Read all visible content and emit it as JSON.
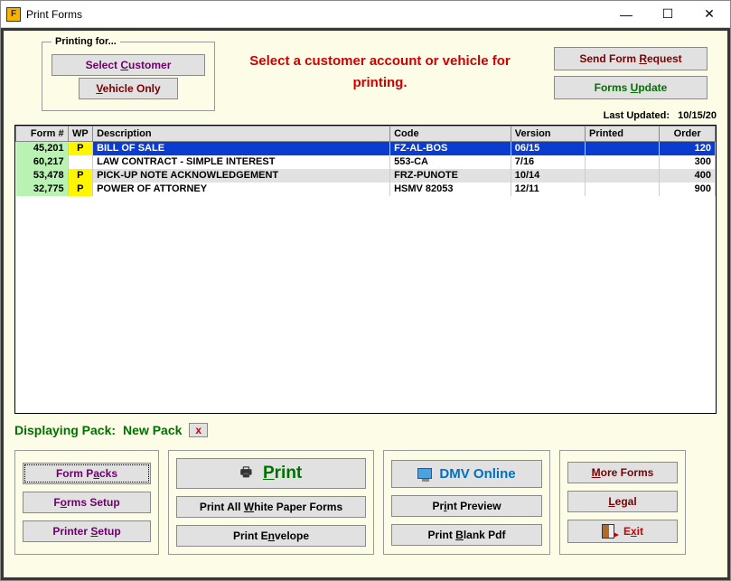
{
  "window": {
    "title": "Print Forms",
    "icon_letter": "F"
  },
  "printing_for": {
    "legend": "Printing for...",
    "select_customer": "Select Customer",
    "vehicle_only": "Vehicle Only"
  },
  "instruction": "Select a customer account or vehicle for printing.",
  "top_right": {
    "send_form_request": "Send Form Request",
    "forms_update": "Forms Update",
    "last_updated_label": "Last Updated:",
    "last_updated_value": "10/15/20"
  },
  "table": {
    "headers": {
      "form_num": "Form #",
      "wp": "WP",
      "description": "Description",
      "code": "Code",
      "version": "Version",
      "printed": "Printed",
      "order": "Order"
    },
    "rows": [
      {
        "form_num": "45,201",
        "wp": "P",
        "description": "BILL OF SALE",
        "code": "FZ-AL-BOS",
        "version": "06/15",
        "printed": "",
        "order": "120",
        "selected": true
      },
      {
        "form_num": "60,217",
        "wp": "",
        "description": "LAW CONTRACT - SIMPLE INTEREST",
        "code": "553-CA",
        "version": "7/16",
        "printed": "",
        "order": "300",
        "selected": false
      },
      {
        "form_num": "53,478",
        "wp": "P",
        "description": "PICK-UP NOTE ACKNOWLEDGEMENT",
        "code": "FRZ-PUNOTE",
        "version": "10/14",
        "printed": "",
        "order": "400",
        "selected": false
      },
      {
        "form_num": "32,775",
        "wp": "P",
        "description": "POWER OF ATTORNEY",
        "code": "HSMV 82053",
        "version": "12/11",
        "printed": "",
        "order": "900",
        "selected": false
      }
    ]
  },
  "pack": {
    "label": "Displaying Pack:",
    "name": "New Pack",
    "close_x": "x"
  },
  "buttons": {
    "form_packs": "Form Packs",
    "forms_setup": "Forms Setup",
    "printer_setup": "Printer Setup",
    "print": "Print",
    "print_all_wp": "Print All White Paper Forms",
    "print_envelope": "Print Envelope",
    "dmv_online": "DMV Online",
    "print_preview": "Print Preview",
    "print_blank_pdf": "Print Blank Pdf",
    "more_forms": "More Forms",
    "legal": "Legal",
    "exit": "Exit"
  }
}
